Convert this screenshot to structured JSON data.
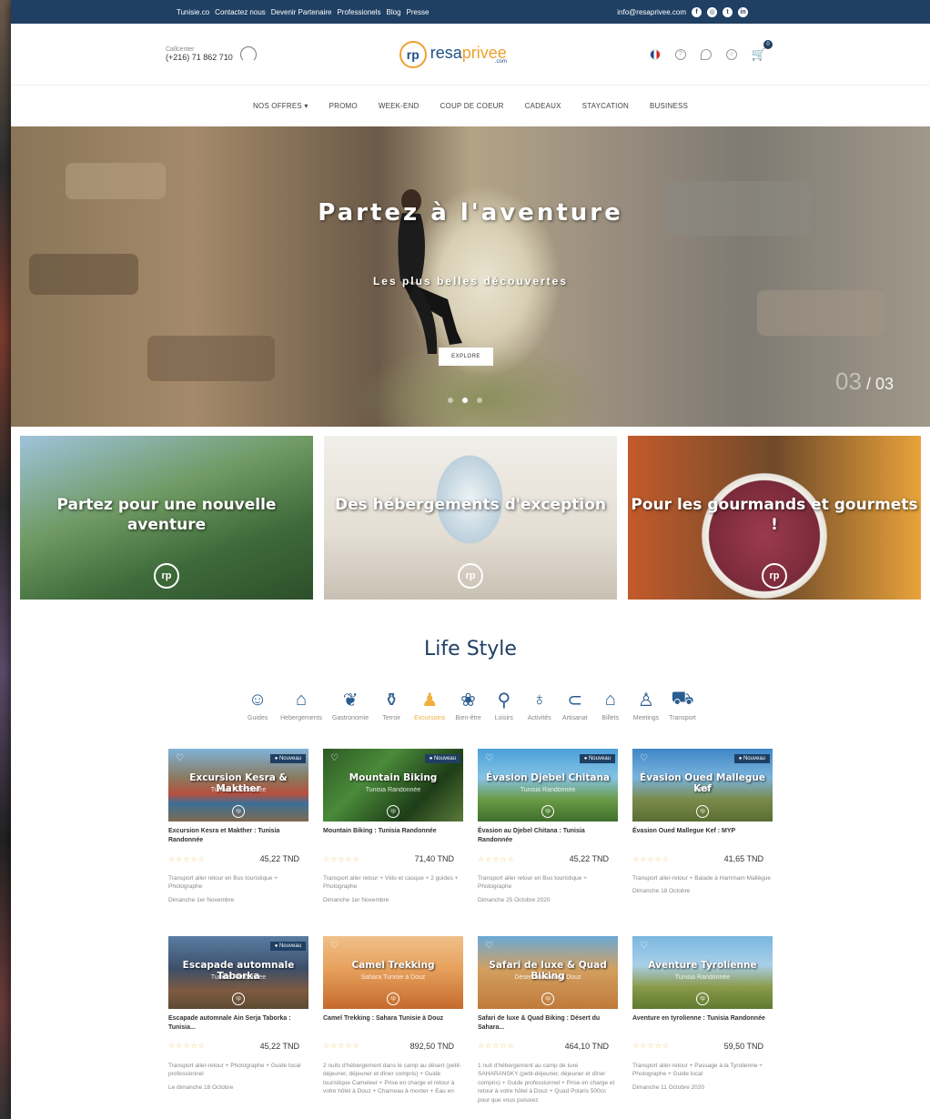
{
  "topbar": {
    "links": [
      "Tunisie.co",
      "Contactez nous",
      "Devenir Partenaire",
      "Professionels",
      "Blog",
      "Presse"
    ],
    "email": "info@resaprivee.com"
  },
  "header": {
    "callcenter_label": "Callcenter",
    "phone": "(+216) 71 862 710",
    "logo_mark": "rp",
    "logo_text_a": "resa",
    "logo_text_b": "privee",
    "logo_com": ".com",
    "cart_count": "0"
  },
  "nav": [
    "NOS OFFRES ▾",
    "PROMO",
    "WEEK-END",
    "COUP DE COEUR",
    "CADEAUX",
    "STAYCATION",
    "BUSINESS"
  ],
  "hero": {
    "title": "Partez à l'aventure",
    "subtitle": "Les plus belles découvertes",
    "button": "EXPLORE",
    "counter_current": "03",
    "counter_total": "/ 03"
  },
  "promos": [
    {
      "title": "Partez pour une nouvelle aventure",
      "badge": "rp"
    },
    {
      "title": "Des hébergements d'exception",
      "badge": "rp"
    },
    {
      "title": "Pour les gourmands et gourmets !",
      "badge": "rp"
    }
  ],
  "lifestyle": {
    "title": "Life Style",
    "categories": [
      "Guides",
      "Hebergements",
      "Gastronomie",
      "Terroir",
      "Excursions",
      "Bien-être",
      "Loisirs",
      "Activités",
      "Artisanat",
      "Billets",
      "Meetings",
      "Transport"
    ],
    "active_category": "Excursions"
  },
  "products": [
    {
      "thumb_title": "Excursion Kesra & Makther",
      "thumb_sub": "Tunisia Randonnée",
      "badge": "● Nouveau",
      "name": "Excursion Kesra et Makther : Tunisia Randonnée",
      "stars": "☆☆☆☆☆",
      "price": "45,22 TND",
      "desc": "Transport aller retour en Bus touristique + Photographe",
      "date": "Dimanche 1er Novembre"
    },
    {
      "thumb_title": "Mountain Biking",
      "thumb_sub": "Tunisia Randonnée",
      "badge": "● Nouveau",
      "name": "Mountain Biking : Tunisia Randonnée",
      "stars": "☆☆☆☆☆",
      "price": "71,40 TND",
      "desc": "Transport aller retour + Vélo et casque + 2 guides + Photographe",
      "date": "Dimanche 1er Novembre"
    },
    {
      "thumb_title": "Évasion Djebel Chitana",
      "thumb_sub": "Tunisia Randonnée",
      "badge": "● Nouveau",
      "name": "Évasion au Djebel Chitana : Tunisia Randonnée",
      "stars": "☆☆☆☆☆",
      "price": "45,22 TND",
      "desc": "Transport aller retour en Bus touristique + Photographe",
      "date": "Dimanche 25 Octobre 2020"
    },
    {
      "thumb_title": "Évasion Oued Mallegue Kef",
      "thumb_sub": "MYP",
      "badge": "● Nouveau",
      "name": "Évasion Oued Mallegue Kef : MYP",
      "stars": "☆☆☆☆☆",
      "price": "41,65 TND",
      "desc": "Transport aller-retour + Balade à Hammam Mallègue",
      "date": "Dimanche 18 Octobre"
    },
    {
      "thumb_title": "Escapade automnale Taborka",
      "thumb_sub": "Tunisia Randonnée",
      "badge": "● Nouveau",
      "name": "Escapade automnale Ain Serja Taborka : Tunisia...",
      "stars": "☆☆☆☆☆",
      "price": "45,22 TND",
      "desc": "Transport aller-retour + Photographe + Guide local professionnel",
      "date": "Le dimanche 18 Octobre"
    },
    {
      "thumb_title": "Camel Trekking",
      "thumb_sub": "Sahara Tunisie à Douz",
      "badge": "",
      "name": "Camel Trekking : Sahara Tunisie à Douz",
      "stars": "☆☆☆☆☆",
      "price": "892,50 TND",
      "desc": "2 nuits d'hébergement dans le camp au désert (petit-déjeuner, déjeuner et dîner compris) + Guide touristique Cameleer + Prise en charge et retour à votre hôtel à Douz + Chameau à monter + Eau en",
      "date": ""
    },
    {
      "thumb_title": "Safari de luxe & Quad Biking",
      "thumb_sub": "Désert du Sahara Douz",
      "badge": "",
      "name": "Safari de luxe & Quad Biking : Désert du Sahara...",
      "stars": "☆☆☆☆☆",
      "price": "464,10 TND",
      "desc": "1 nuit d'hébergement au camp de luxe SAHARANSKY (petit-déjeuner, déjeuner et dîner compris) + Guide professionnel + Prise en charge et retour à votre hôtel à Douz + Quad Polaris 500cc pour que vous puissiez",
      "date": ""
    },
    {
      "thumb_title": "Aventure Tyrolienne",
      "thumb_sub": "Tunisia Randonnée",
      "badge": "",
      "name": "Aventure en tyrolienne : Tunisia Randonnée",
      "stars": "☆☆☆☆☆",
      "price": "59,50 TND",
      "desc": "Transport aller-retour + Passage à la Tyrolienne + Photographe + Guide local",
      "date": "Dimanche 11 Octobre 2020"
    }
  ]
}
